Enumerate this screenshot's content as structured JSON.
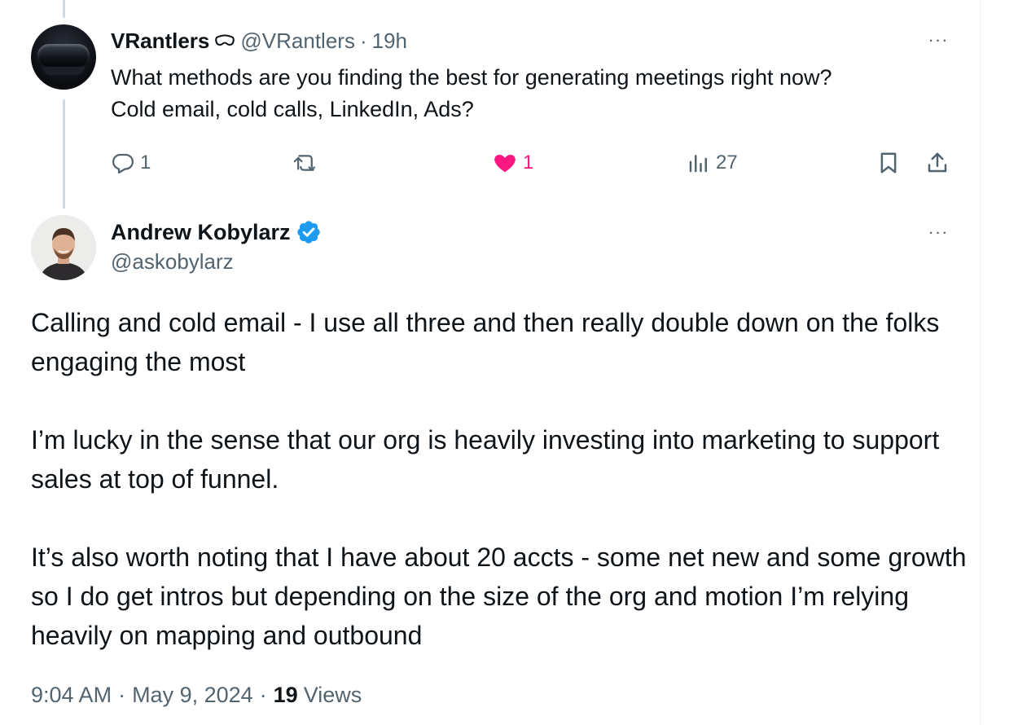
{
  "parent_tweet": {
    "display_name": "VRantlers",
    "handle": "@VRantlers",
    "separator": "·",
    "time": "19h",
    "text_line1": "What methods are you finding the best for generating meetings right now?",
    "text_line2": "Cold email, cold calls, LinkedIn, Ads?",
    "more_label": "···",
    "reply_count": "1",
    "like_count": "1",
    "view_count": "27",
    "avatar_icon": "vr-headset-avatar",
    "like_color": "#f91880"
  },
  "reply_tweet": {
    "display_name": "Andrew Kobylarz",
    "handle": "@askobylarz",
    "more_label": "···",
    "verified_icon": "verified-badge-icon",
    "verified_color": "#1d9bf0",
    "paragraphs": [
      "Calling and cold email - I use all three and then really double down on the folks engaging the most",
      "I’m lucky in the sense that our org is heavily investing into marketing to support sales at top of funnel.",
      "It’s also worth noting that I have about 20 accts - some net new and some growth so I do get intros but depending on the size of the org and motion I’m relying heavily on mapping and outbound"
    ],
    "timestamp": "9:04 AM",
    "date": "May 9, 2024",
    "separator": "·",
    "views_count": "19",
    "views_label": "Views"
  },
  "colors": {
    "text_primary": "#0f1419",
    "text_secondary": "#536471",
    "thread_line": "#cfd9de"
  }
}
